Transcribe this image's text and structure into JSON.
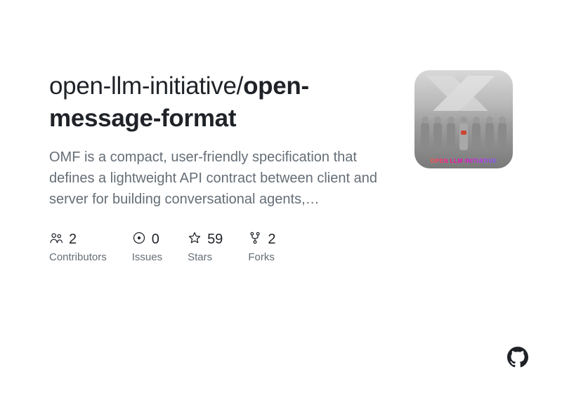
{
  "repo": {
    "owner": "open-llm-initiative",
    "slash": "/",
    "name": "open-message-format"
  },
  "description": "OMF is a compact, user-friendly specification that defines a lightweight API contract between client and server for building conversational agents,…",
  "stats": [
    {
      "value": "2",
      "label": "Contributors",
      "icon": "people-icon"
    },
    {
      "value": "0",
      "label": "Issues",
      "icon": "issue-icon"
    },
    {
      "value": "59",
      "label": "Stars",
      "icon": "star-icon"
    },
    {
      "value": "2",
      "label": "Forks",
      "icon": "fork-icon"
    }
  ],
  "thumb_caption": "OPEN LLM INITIATIVE"
}
